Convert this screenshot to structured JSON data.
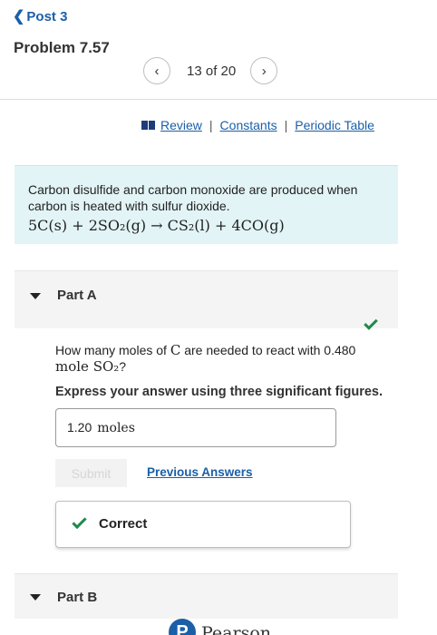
{
  "nav": {
    "back_label": "Post 3"
  },
  "problem": {
    "title": "Problem 7.57"
  },
  "pager": {
    "text": "13 of 20",
    "prev_icon": "chevron-left-icon",
    "next_icon": "chevron-right-icon"
  },
  "links": {
    "review": "Review",
    "constants": "Constants",
    "periodic_table": "Periodic Table",
    "separator": "|"
  },
  "intro": {
    "text": "Carbon disulfide and carbon monoxide are produced when carbon is heated with sulfur dioxide.",
    "equation": "5C(s) + 2SO₂(g) → CS₂(l) + 4CO(g)"
  },
  "part_a": {
    "title": "Part A",
    "question_prefix": "How many moles of ",
    "question_symbol": "C",
    "question_mid": " are needed to react with 0.480",
    "question_line2": "mole SO₂",
    "question_end": "?",
    "instruction": "Express your answer using three significant figures.",
    "answer_value": "1.20",
    "answer_unit": "moles",
    "submit_label": "Submit",
    "previous_answers_label": "Previous Answers",
    "feedback_label": "Correct",
    "status_color": "#1e8a4a"
  },
  "part_b": {
    "title": "Part B"
  },
  "footer": {
    "logo_letter": "P",
    "brand": "Pearson"
  },
  "colors": {
    "link": "#1a5fa8",
    "intro_bg": "#e2f4f6",
    "correct": "#1e8a4a"
  }
}
